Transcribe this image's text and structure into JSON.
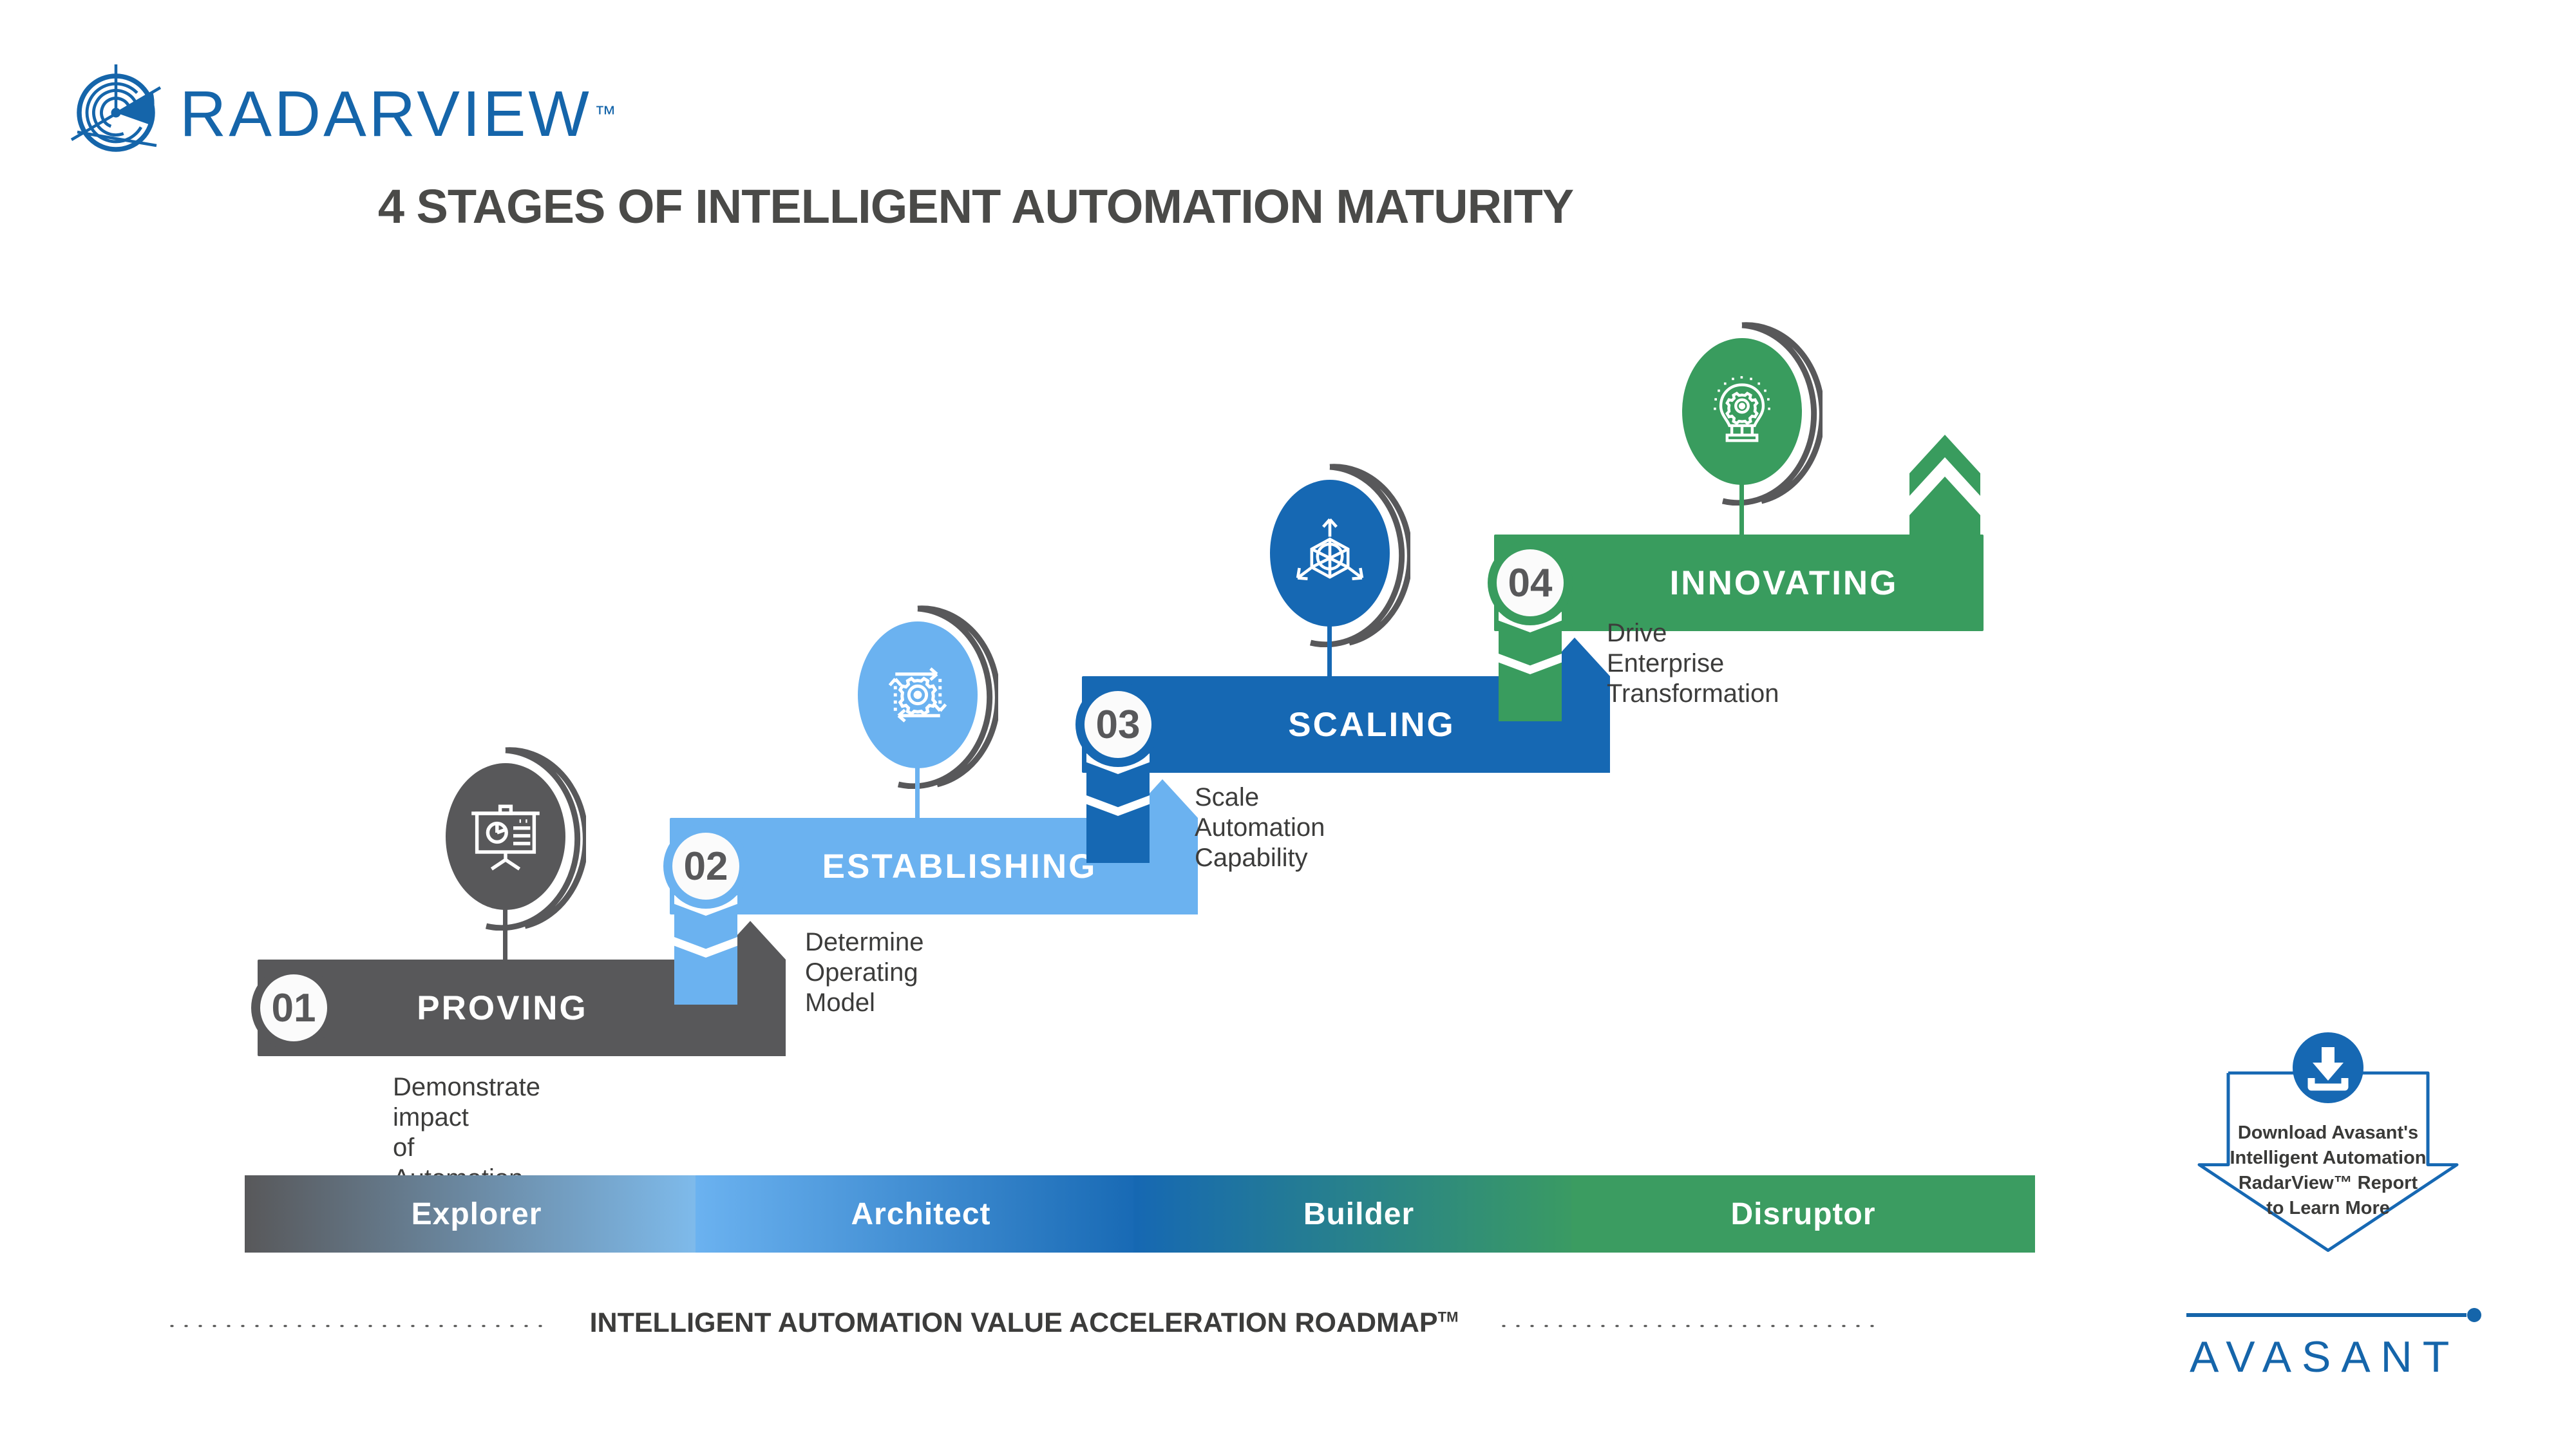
{
  "brand": {
    "name": "RADARVIEW",
    "tm": "™",
    "logo_icon": "radar-logo-icon",
    "color": "#1565aa"
  },
  "page_title": "4 STAGES OF INTELLIGENT AUTOMATION MATURITY",
  "steps": [
    {
      "number": "01",
      "label": "PROVING",
      "description": "Demonstrate impact\nof Automation",
      "desc_line1": "Demonstrate impact",
      "desc_line2": "of Automation",
      "color": "#58585a",
      "icon": "presentation-chart-icon"
    },
    {
      "number": "02",
      "label": "ESTABLISHING",
      "description": "Determine\nOperating Model",
      "desc_line1": "Determine",
      "desc_line2": "Operating Model",
      "color": "#6bb2f0",
      "icon": "gear-process-cycle-icon"
    },
    {
      "number": "03",
      "label": "SCALING",
      "description": "Scale Automation\nCapability",
      "desc_line1": "Scale Automation",
      "desc_line2": "Capability",
      "color": "#1668b3",
      "icon": "cube-expand-network-icon"
    },
    {
      "number": "04",
      "label": "INNOVATING",
      "description": "Drive Enterprise\nTransformation",
      "desc_line1": "Drive Enterprise",
      "desc_line2": "Transformation",
      "color": "#399c5e",
      "icon": "lightbulb-gear-icon"
    }
  ],
  "flow": {
    "segments": [
      {
        "label": "Explorer",
        "from": "#58585a",
        "to": "#7fbdef"
      },
      {
        "label": "Architect",
        "from": "#6bb2f0",
        "to": "#1668b3"
      },
      {
        "label": "Builder",
        "from": "#1668b3",
        "to": "#399c5e"
      },
      {
        "label": "Disruptor",
        "from": "#3b9c61",
        "to": "#3b9c61"
      }
    ]
  },
  "caption": {
    "text": "INTELLIGENT AUTOMATION VALUE ACCELERATION ROADMAP",
    "tm": "TM"
  },
  "cta": {
    "icon": "download-icon",
    "line1": "Download Avasant's",
    "line2": "Intelligent Automation",
    "line3": "RadarView™ Report",
    "line4": "to Learn More",
    "color": "#1668b3"
  },
  "avasant": {
    "name": "AVASANT",
    "color": "#1565aa"
  }
}
